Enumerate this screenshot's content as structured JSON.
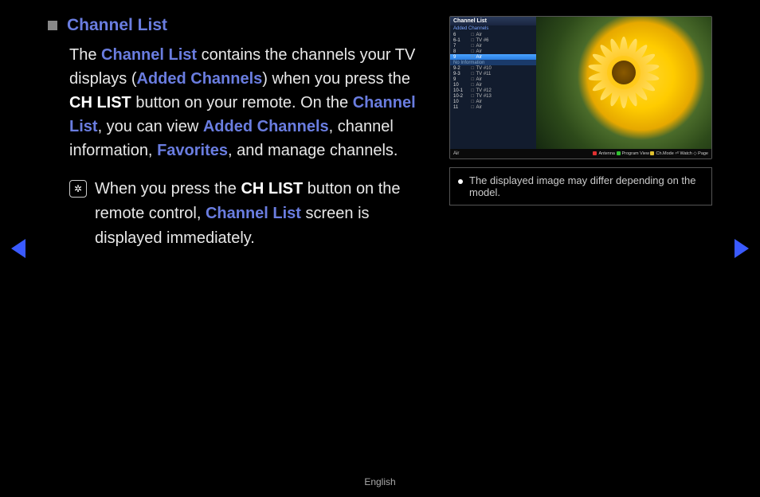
{
  "heading": "Channel List",
  "para1": {
    "t1": "The ",
    "l1": "Channel List",
    "t2": " contains the channels your TV displays (",
    "l2": "Added Channels",
    "t3": ") when you press the ",
    "b1": "CH LIST",
    "t4": " button on your remote. On the ",
    "l3": "Channel List",
    "t5": ", you can view ",
    "l4": "Added Channels",
    "t6": ", channel information, ",
    "l5": "Favorites",
    "t7": ", and manage channels."
  },
  "noteIcon": "✲",
  "notePara": {
    "t1": "When you press the ",
    "b1": "CH LIST",
    "t2": " button on the remote control, ",
    "l1": "Channel List",
    "t3": " screen is displayed immediately."
  },
  "screenshot": {
    "panelTitle": "Channel List",
    "panelSub": "Added Channels",
    "rows": [
      {
        "num": "6",
        "name": "Air"
      },
      {
        "num": "6-1",
        "name": "TV #6"
      },
      {
        "num": "7",
        "name": "Air"
      },
      {
        "num": "8",
        "name": "Air"
      },
      {
        "num": "9",
        "name": "Air",
        "hl": true
      },
      {
        "num": "",
        "name": "No Information",
        "noinf": true
      },
      {
        "num": "9-2",
        "name": "TV #10"
      },
      {
        "num": "9-3",
        "name": "TV #11"
      },
      {
        "num": "9",
        "name": "Air"
      },
      {
        "num": "10",
        "name": "Air"
      },
      {
        "num": "10-1",
        "name": "TV #12"
      },
      {
        "num": "10-2",
        "name": "TV #13"
      },
      {
        "num": "10",
        "name": "Air"
      },
      {
        "num": "11",
        "name": "Air"
      }
    ],
    "bottom": {
      "left": "Air",
      "items": [
        {
          "color": "red",
          "label": "Antenna"
        },
        {
          "color": "green",
          "label": "Program View"
        },
        {
          "color": "yellow",
          "label": "Ch.Mode"
        },
        {
          "icon": "⏎",
          "label": "Watch"
        },
        {
          "icon": "◇",
          "label": "Page"
        }
      ]
    }
  },
  "caption": "The displayed image may differ depending on the model.",
  "footer": "English"
}
